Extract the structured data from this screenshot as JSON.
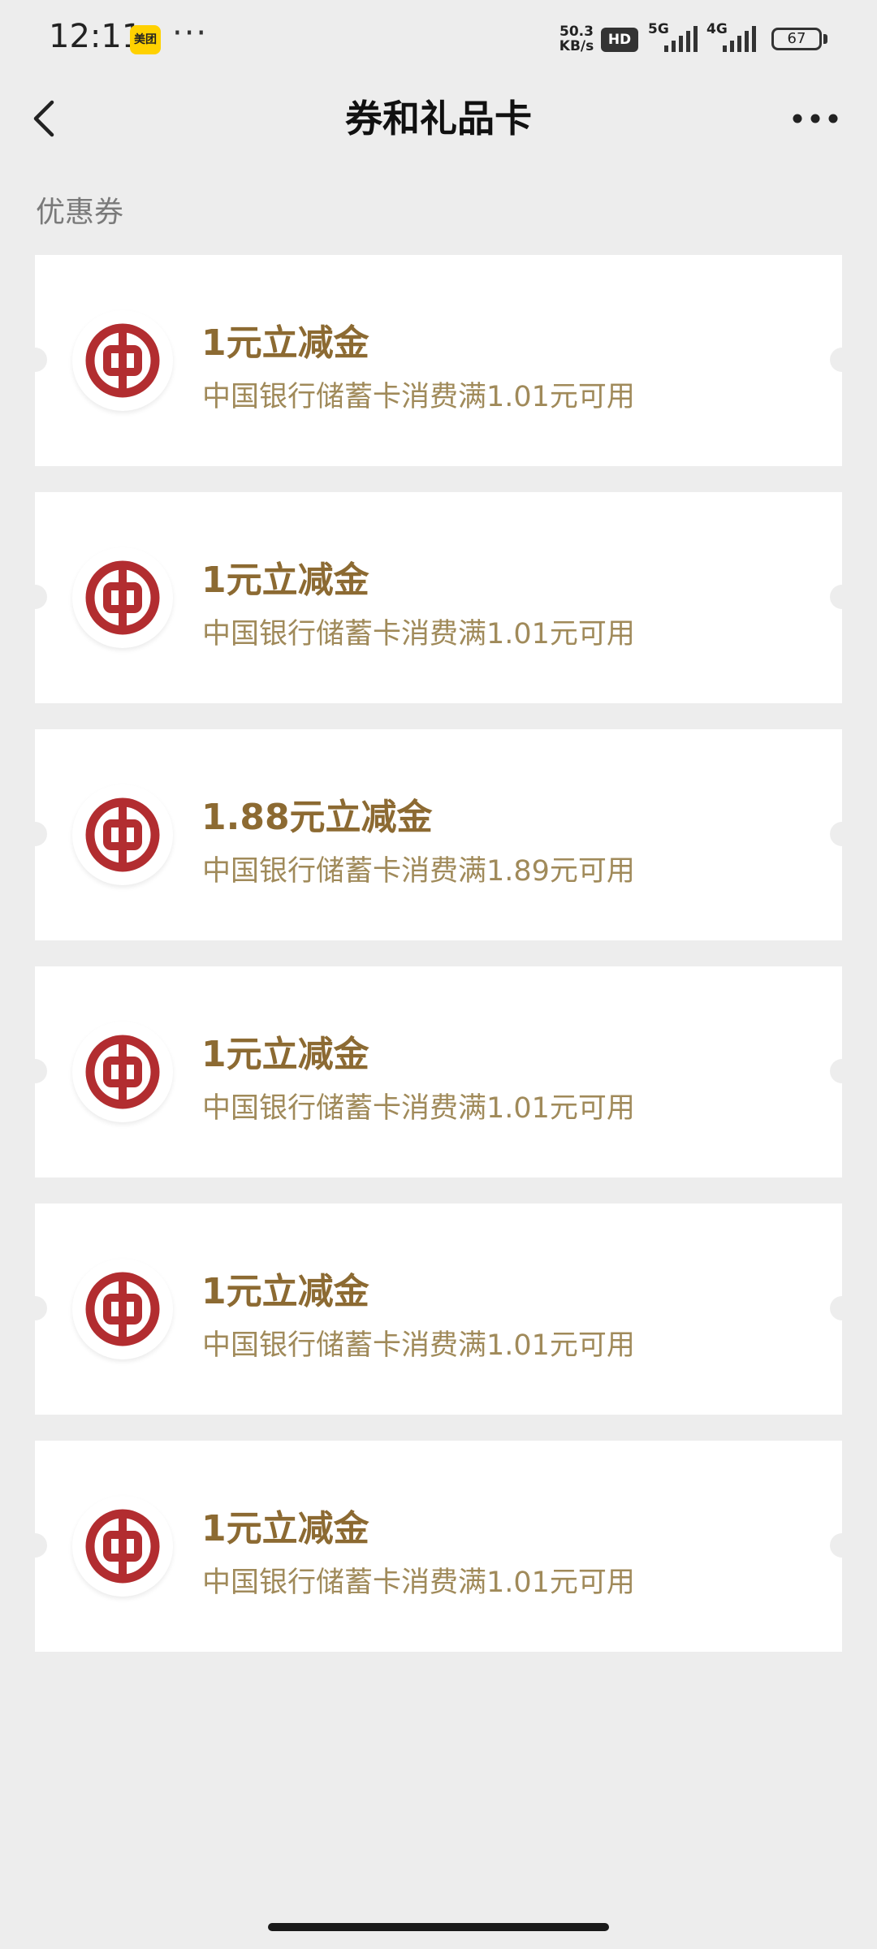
{
  "status_bar": {
    "time": "12:11",
    "app_badge": "美团",
    "dots": "···",
    "net_speed_value": "50.3",
    "net_speed_unit": "KB/s",
    "hd_label": "HD",
    "signal_1_label": "5G",
    "signal_2_label": "4G",
    "battery": "67"
  },
  "header": {
    "title": "券和礼品卡"
  },
  "section": {
    "label": "优惠券"
  },
  "coupons": [
    {
      "title": "1元立减金",
      "desc": "中国银行储蓄卡消费满1.01元可用"
    },
    {
      "title": "1元立减金",
      "desc": "中国银行储蓄卡消费满1.01元可用"
    },
    {
      "title": "1.88元立减金",
      "desc": "中国银行储蓄卡消费满1.89元可用"
    },
    {
      "title": "1元立减金",
      "desc": "中国银行储蓄卡消费满1.01元可用"
    },
    {
      "title": "1元立减金",
      "desc": "中国银行储蓄卡消费满1.01元可用"
    },
    {
      "title": "1元立减金",
      "desc": "中国银行储蓄卡消费满1.01元可用"
    }
  ],
  "colors": {
    "background": "#ededed",
    "coupon_title": "#8c6a32",
    "coupon_desc": "#a08a5a",
    "bank_logo": "#b22d30"
  },
  "icons": {
    "back": "chevron-left-icon",
    "more": "more-dots-icon",
    "coupon_logo": "bank-of-china-logo-icon"
  }
}
